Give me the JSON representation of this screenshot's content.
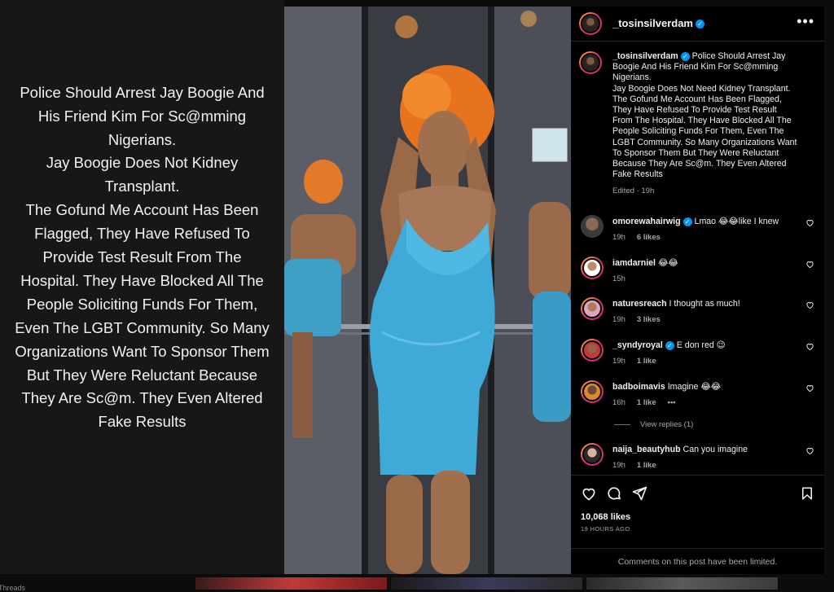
{
  "slide_text": {
    "lines": [
      "Police Should Arrest Jay Boogie And",
      "His Friend Kim For Sc@mming",
      "Nigerians.",
      "Jay Boogie Does Not Kidney",
      "Transplant.",
      "The Gofund Me Account Has Been",
      "Flagged, They Have Refused To",
      "Provide Test Result From The",
      "Hospital. They Have Blocked All The",
      "People Soliciting Funds For Them,",
      "Even The LGBT Community. So Many",
      "Organizations Want To Sponsor Them",
      "But They Were Reluctant Because",
      "They Are Sc@m. They Even Altered",
      "Fake Results"
    ]
  },
  "header": {
    "username": "_tosinsilverdam",
    "verified_icon": "verified-badge-icon",
    "more_label": "•••"
  },
  "caption": {
    "username": "_tosinsilverdam",
    "lines": [
      "Police Should Arrest Jay",
      "Boogie And His Friend Kim For Sc@mming",
      "Nigerians.",
      "Jay Boogie Does Not Need Kidney Transplant.",
      "The Gofund Me Account Has Been Flagged,",
      "They Have Refused To Provide Test Result",
      "From The Hospital. They Have Blocked All The",
      "People Soliciting Funds For Them, Even The",
      "LGBT Community. So Many Organizations Want",
      "To Sponsor Them But They Were Reluctant",
      "Because They Are Sc@m. They Even Altered",
      "Fake Results"
    ],
    "edited": "Edited · 19h"
  },
  "comments": [
    {
      "username": "omorewahairwig",
      "verified": true,
      "text": "Lmao 😂😂like I knew",
      "time": "19h",
      "likes": "6 likes",
      "more": ""
    },
    {
      "username": "iamdarniel",
      "verified": false,
      "text": "😂😂",
      "time": "15h",
      "likes": "",
      "more": ""
    },
    {
      "username": "naturesreach",
      "verified": false,
      "text": "I thought as much!",
      "time": "19h",
      "likes": "3 likes",
      "more": ""
    },
    {
      "username": "_syndyroyal",
      "verified": true,
      "text": "E don red 😉",
      "time": "19h",
      "likes": "1 like",
      "more": ""
    },
    {
      "username": "badboimavis",
      "verified": false,
      "text": "Imagine 😂😂",
      "time": "16h",
      "likes": "1 like",
      "more": "•••"
    },
    {
      "username": "naija_beautyhub",
      "verified": false,
      "text": "Can you imagine",
      "time": "19h",
      "likes": "1 like",
      "more": ""
    }
  ],
  "view_replies": "View replies (1)",
  "actions": {
    "icons": [
      "heart-icon",
      "comment-icon",
      "share-icon",
      "bookmark-icon"
    ],
    "likes": "10,068 likes",
    "date": "19 HOURS AGO"
  },
  "comments_limited": "Comments on this post have been limited.",
  "bottom": {
    "threads_label": "Threads"
  },
  "colors": {
    "background": "#000000",
    "slide_background": "#171717",
    "verified": "#0095f6",
    "dress": "#3fa9d8",
    "hair": "#e8731e",
    "muted_text": "#a8a8a8"
  }
}
